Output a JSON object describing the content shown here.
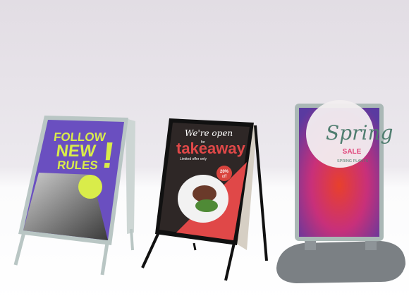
{
  "signs": {
    "left": {
      "line1": "FOLLOW",
      "line2": "NEW",
      "line3": "RULES",
      "exclaim": "!",
      "colors": {
        "poster": "#6a4fc0",
        "accent": "#d9ec4a",
        "frame": "#b9c6c4"
      }
    },
    "middle": {
      "line1": "We're open",
      "line2": "for",
      "line3": "takeaway",
      "line4": "Limited offer only",
      "badge_line1": "20%",
      "badge_line2": "off",
      "colors": {
        "poster": "#2e2726",
        "accent": "#e04848",
        "frame": "#111111"
      }
    },
    "right": {
      "line1": "Spring",
      "line2": "SALE",
      "line3": "SPRING PLANTS",
      "colors": {
        "script": "#4f7d6f",
        "sale": "#e0447a",
        "frame": "#aab8b6",
        "base": "#7b8084"
      }
    }
  }
}
